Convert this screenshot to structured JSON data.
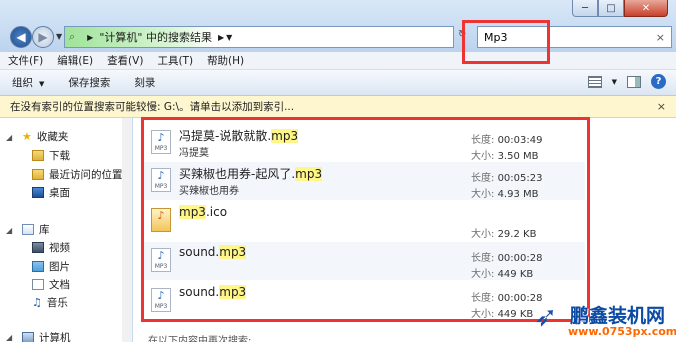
{
  "window": {
    "min_label": "─",
    "max_label": "□",
    "close_label": "✕"
  },
  "address": {
    "icon_glyph": "⌕",
    "arrow1": "▶",
    "text": "\"计算机\" 中的搜索结果",
    "arrow2": "▶",
    "drop": "▼",
    "refresh": "↻"
  },
  "search": {
    "value": "Mp3",
    "clear": "×"
  },
  "menu": [
    "文件(F)",
    "编辑(E)",
    "查看(V)",
    "工具(T)",
    "帮助(H)"
  ],
  "toolbar": {
    "organize": "组织",
    "organize_arrow": "▼",
    "save_search": "保存搜索",
    "burn": "刻录",
    "view_arrow": "▼",
    "help": "?"
  },
  "infobar": {
    "text": "在没有索引的位置搜索可能较慢: G:\\。请单击以添加到索引...",
    "close": "×"
  },
  "sidebar": {
    "favorites": "收藏夹",
    "downloads": "下载",
    "recent": "最近访问的位置",
    "desktop": "桌面",
    "libraries": "库",
    "videos": "视频",
    "pictures": "图片",
    "documents": "文档",
    "music": "音乐",
    "computer": "计算机"
  },
  "results": [
    {
      "name_pre": "冯提莫-说散就散.",
      "name_hl": "mp3",
      "sub": "冯提莫",
      "icon": "MP3",
      "len_label": "长度:",
      "len": "00:03:49",
      "size_label": "大小:",
      "size": "3.50 MB"
    },
    {
      "name_pre": "买辣椒也用券-起风了.",
      "name_hl": "mp3",
      "sub": "买辣椒也用券",
      "icon": "MP3",
      "len_label": "长度:",
      "len": "00:05:23",
      "size_label": "大小:",
      "size": "4.93 MB"
    },
    {
      "name_pre": "",
      "name_hl": "mp3",
      "name_post": ".ico",
      "sub": "",
      "icon": "",
      "len_label": "",
      "len": "",
      "size_label": "大小:",
      "size": "29.2 KB"
    },
    {
      "name_pre": "sound.",
      "name_hl": "mp3",
      "sub": "",
      "icon": "MP3",
      "len_label": "长度:",
      "len": "00:00:28",
      "size_label": "大小:",
      "size": "449 KB"
    },
    {
      "name_pre": "sound.",
      "name_hl": "mp3",
      "sub": "",
      "icon": "MP3",
      "len_label": "长度:",
      "len": "00:00:28",
      "size_label": "大小:",
      "size": "449 KB"
    }
  ],
  "bottom_text": "在以下内容中再次搜索:",
  "watermark": {
    "brand": "鹏鑫装机网",
    "url": "www.0753px.com"
  }
}
